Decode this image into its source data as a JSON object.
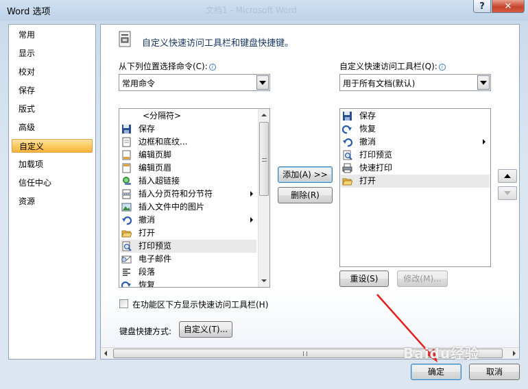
{
  "window": {
    "title": "Word 选项",
    "background_title": "文档1 - Microsoft Word",
    "help_label": "?",
    "close_label": "✕"
  },
  "nav": {
    "items": [
      "常用",
      "显示",
      "校对",
      "保存",
      "版式",
      "高级",
      "自定义",
      "加载项",
      "信任中心",
      "资源"
    ],
    "selected": "自定义"
  },
  "header": {
    "text": "自定义快速访问工具栏和键盘快捷键。"
  },
  "left": {
    "label": "从下列位置选择命令(C):",
    "combo_value": "常用命令",
    "items": [
      {
        "text": "<分隔符>",
        "icon": "separator",
        "submenu": false
      },
      {
        "text": "保存",
        "icon": "save-icon",
        "submenu": false
      },
      {
        "text": "边框和底纹...",
        "icon": "border-icon",
        "submenu": false
      },
      {
        "text": "编辑页脚",
        "icon": "footer-icon",
        "submenu": false
      },
      {
        "text": "编辑页眉",
        "icon": "header-icon",
        "submenu": false
      },
      {
        "text": "插入超链接",
        "icon": "hyperlink-icon",
        "submenu": false
      },
      {
        "text": "插入分页符和分节符",
        "icon": "page-break-icon",
        "submenu": true
      },
      {
        "text": "插入文件中的图片",
        "icon": "picture-icon",
        "submenu": false
      },
      {
        "text": "撤消",
        "icon": "undo-icon",
        "submenu": true
      },
      {
        "text": "打开",
        "icon": "open-folder-icon",
        "submenu": false
      },
      {
        "text": "打印预览",
        "icon": "print-preview-icon",
        "submenu": false,
        "selected": true
      },
      {
        "text": "电子邮件",
        "icon": "email-icon",
        "submenu": false
      },
      {
        "text": "段落",
        "icon": "paragraph-icon",
        "submenu": false
      },
      {
        "text": "恢复",
        "icon": "redo-icon",
        "submenu": false
      }
    ]
  },
  "right": {
    "label": "自定义快速访问工具栏(Q):",
    "combo_value": "用于所有文档(默认)",
    "items": [
      {
        "text": "保存",
        "icon": "save-icon",
        "submenu": false
      },
      {
        "text": "恢复",
        "icon": "redo-icon",
        "submenu": false
      },
      {
        "text": "撤消",
        "icon": "undo-icon",
        "submenu": true
      },
      {
        "text": "打印预览",
        "icon": "print-preview-icon",
        "submenu": false
      },
      {
        "text": "快速打印",
        "icon": "quick-print-icon",
        "submenu": false
      },
      {
        "text": "打开",
        "icon": "open-folder-icon",
        "submenu": false,
        "selected": true
      }
    ]
  },
  "buttons": {
    "add": "添加(A) >>",
    "remove": "删除(R)",
    "reset": "重设(S)",
    "modify": "修改(M)...",
    "customize": "自定义(T)...",
    "ok": "确定",
    "cancel": "取消"
  },
  "checkbox": {
    "label": "在功能区下方显示快速访问工具栏(H)",
    "checked": false
  },
  "shortcut": {
    "label": "键盘快捷方式:"
  },
  "watermark": {
    "text": "Baidu经验"
  }
}
